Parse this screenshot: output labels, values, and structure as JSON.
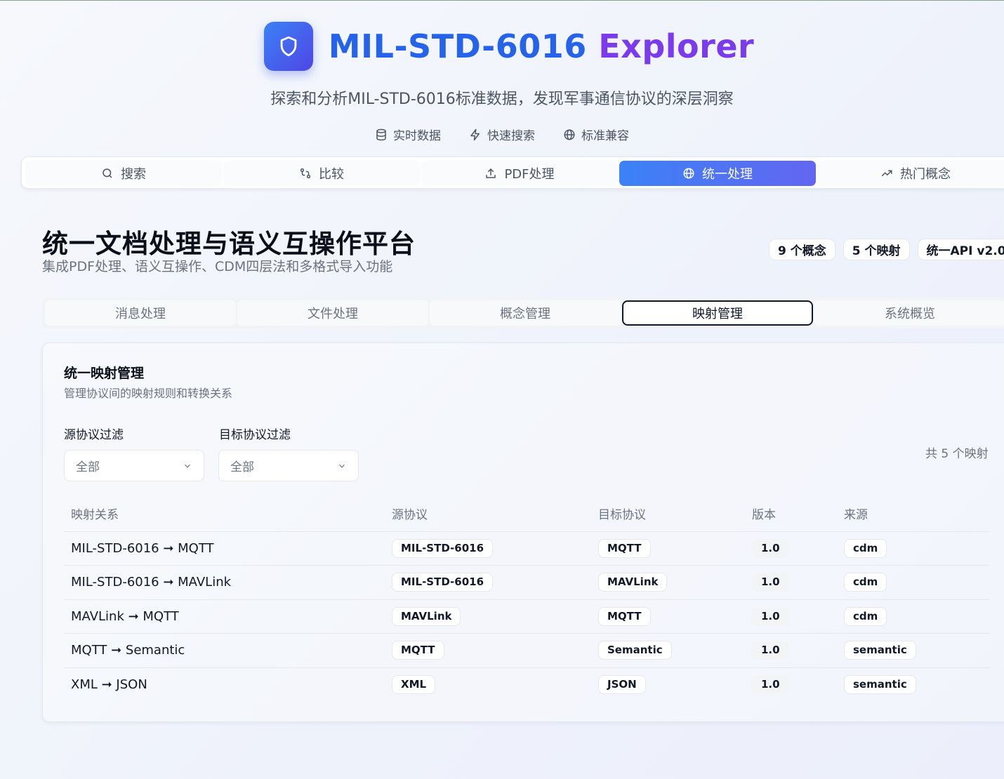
{
  "app": {
    "title_part1": "MIL-STD-6016",
    "title_part2": "Explorer",
    "subtitle": "探索和分析MIL-STD-6016标准数据，发现军事通信协议的深层洞察",
    "features": [
      {
        "icon": "database-icon",
        "label": "实时数据"
      },
      {
        "icon": "zap-icon",
        "label": "快速搜索"
      },
      {
        "icon": "globe-icon",
        "label": "标准兼容"
      }
    ]
  },
  "main_tabs": [
    {
      "icon": "search-icon",
      "label": "搜索"
    },
    {
      "icon": "compare-icon",
      "label": "比较"
    },
    {
      "icon": "upload-icon",
      "label": "PDF处理"
    },
    {
      "icon": "globe-icon",
      "label": "统一处理"
    },
    {
      "icon": "trending-icon",
      "label": "热门概念"
    }
  ],
  "active_main_tab": "统一处理",
  "section": {
    "title": "统一文档处理与语义互操作平台",
    "subtitle": "集成PDF处理、语义互操作、CDM四层法和多格式导入功能",
    "badges": [
      "9 个概念",
      "5 个映射",
      "统一API v2.0"
    ]
  },
  "sub_tabs": [
    "消息处理",
    "文件处理",
    "概念管理",
    "映射管理",
    "系统概览"
  ],
  "active_sub_tab": "映射管理",
  "card": {
    "title": "统一映射管理",
    "subtitle": "管理协议间的映射规则和转换关系",
    "source_filter": {
      "label": "源协议过滤",
      "value": "全部"
    },
    "target_filter": {
      "label": "目标协议过滤",
      "value": "全部"
    },
    "total": "共 5 个映射"
  },
  "table": {
    "headers": [
      "映射关系",
      "源协议",
      "目标协议",
      "版本",
      "来源"
    ],
    "rows": [
      {
        "mapping": "MIL-STD-6016 ➞ MQTT",
        "source": "MIL-STD-6016",
        "target": "MQTT",
        "version": "1.0",
        "origin": "cdm"
      },
      {
        "mapping": "MIL-STD-6016 ➞ MAVLink",
        "source": "MIL-STD-6016",
        "target": "MAVLink",
        "version": "1.0",
        "origin": "cdm"
      },
      {
        "mapping": "MAVLink ➞ MQTT",
        "source": "MAVLink",
        "target": "MQTT",
        "version": "1.0",
        "origin": "cdm"
      },
      {
        "mapping": "MQTT ➞ Semantic",
        "source": "MQTT",
        "target": "Semantic",
        "version": "1.0",
        "origin": "semantic"
      },
      {
        "mapping": "XML ➞ JSON",
        "source": "XML",
        "target": "JSON",
        "version": "1.0",
        "origin": "semantic"
      }
    ]
  },
  "colors": {
    "accent_blue": "#3b82f6",
    "accent_indigo": "#6366f1",
    "title_blue": "#2563eb",
    "title_purple": "#7c3aed"
  }
}
